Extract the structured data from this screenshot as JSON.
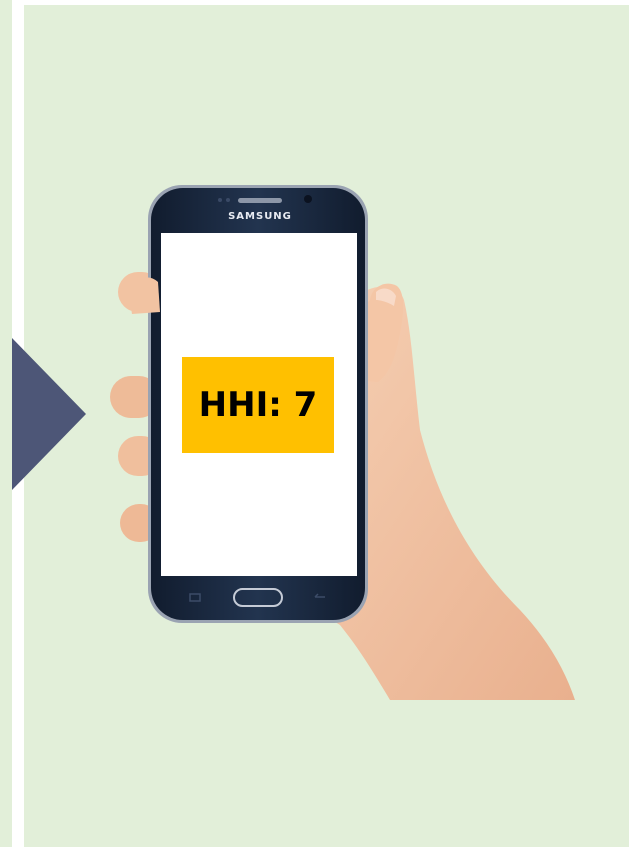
{
  "phone": {
    "brand": "SAMSUNG"
  },
  "screen": {
    "badge_text": "HHI: 7"
  },
  "colors": {
    "panel_background": "#e2efd9",
    "arrow": "#4d5677",
    "badge_background": "#ffc000",
    "phone_body": "#1c2c45",
    "screen": "#ffffff",
    "skin": "#f4c6a6"
  },
  "icons": {
    "arrow": "play-arrow-icon",
    "home_button": "home-button-icon",
    "back_button": "back-icon",
    "recent_apps": "recent-apps-icon"
  }
}
